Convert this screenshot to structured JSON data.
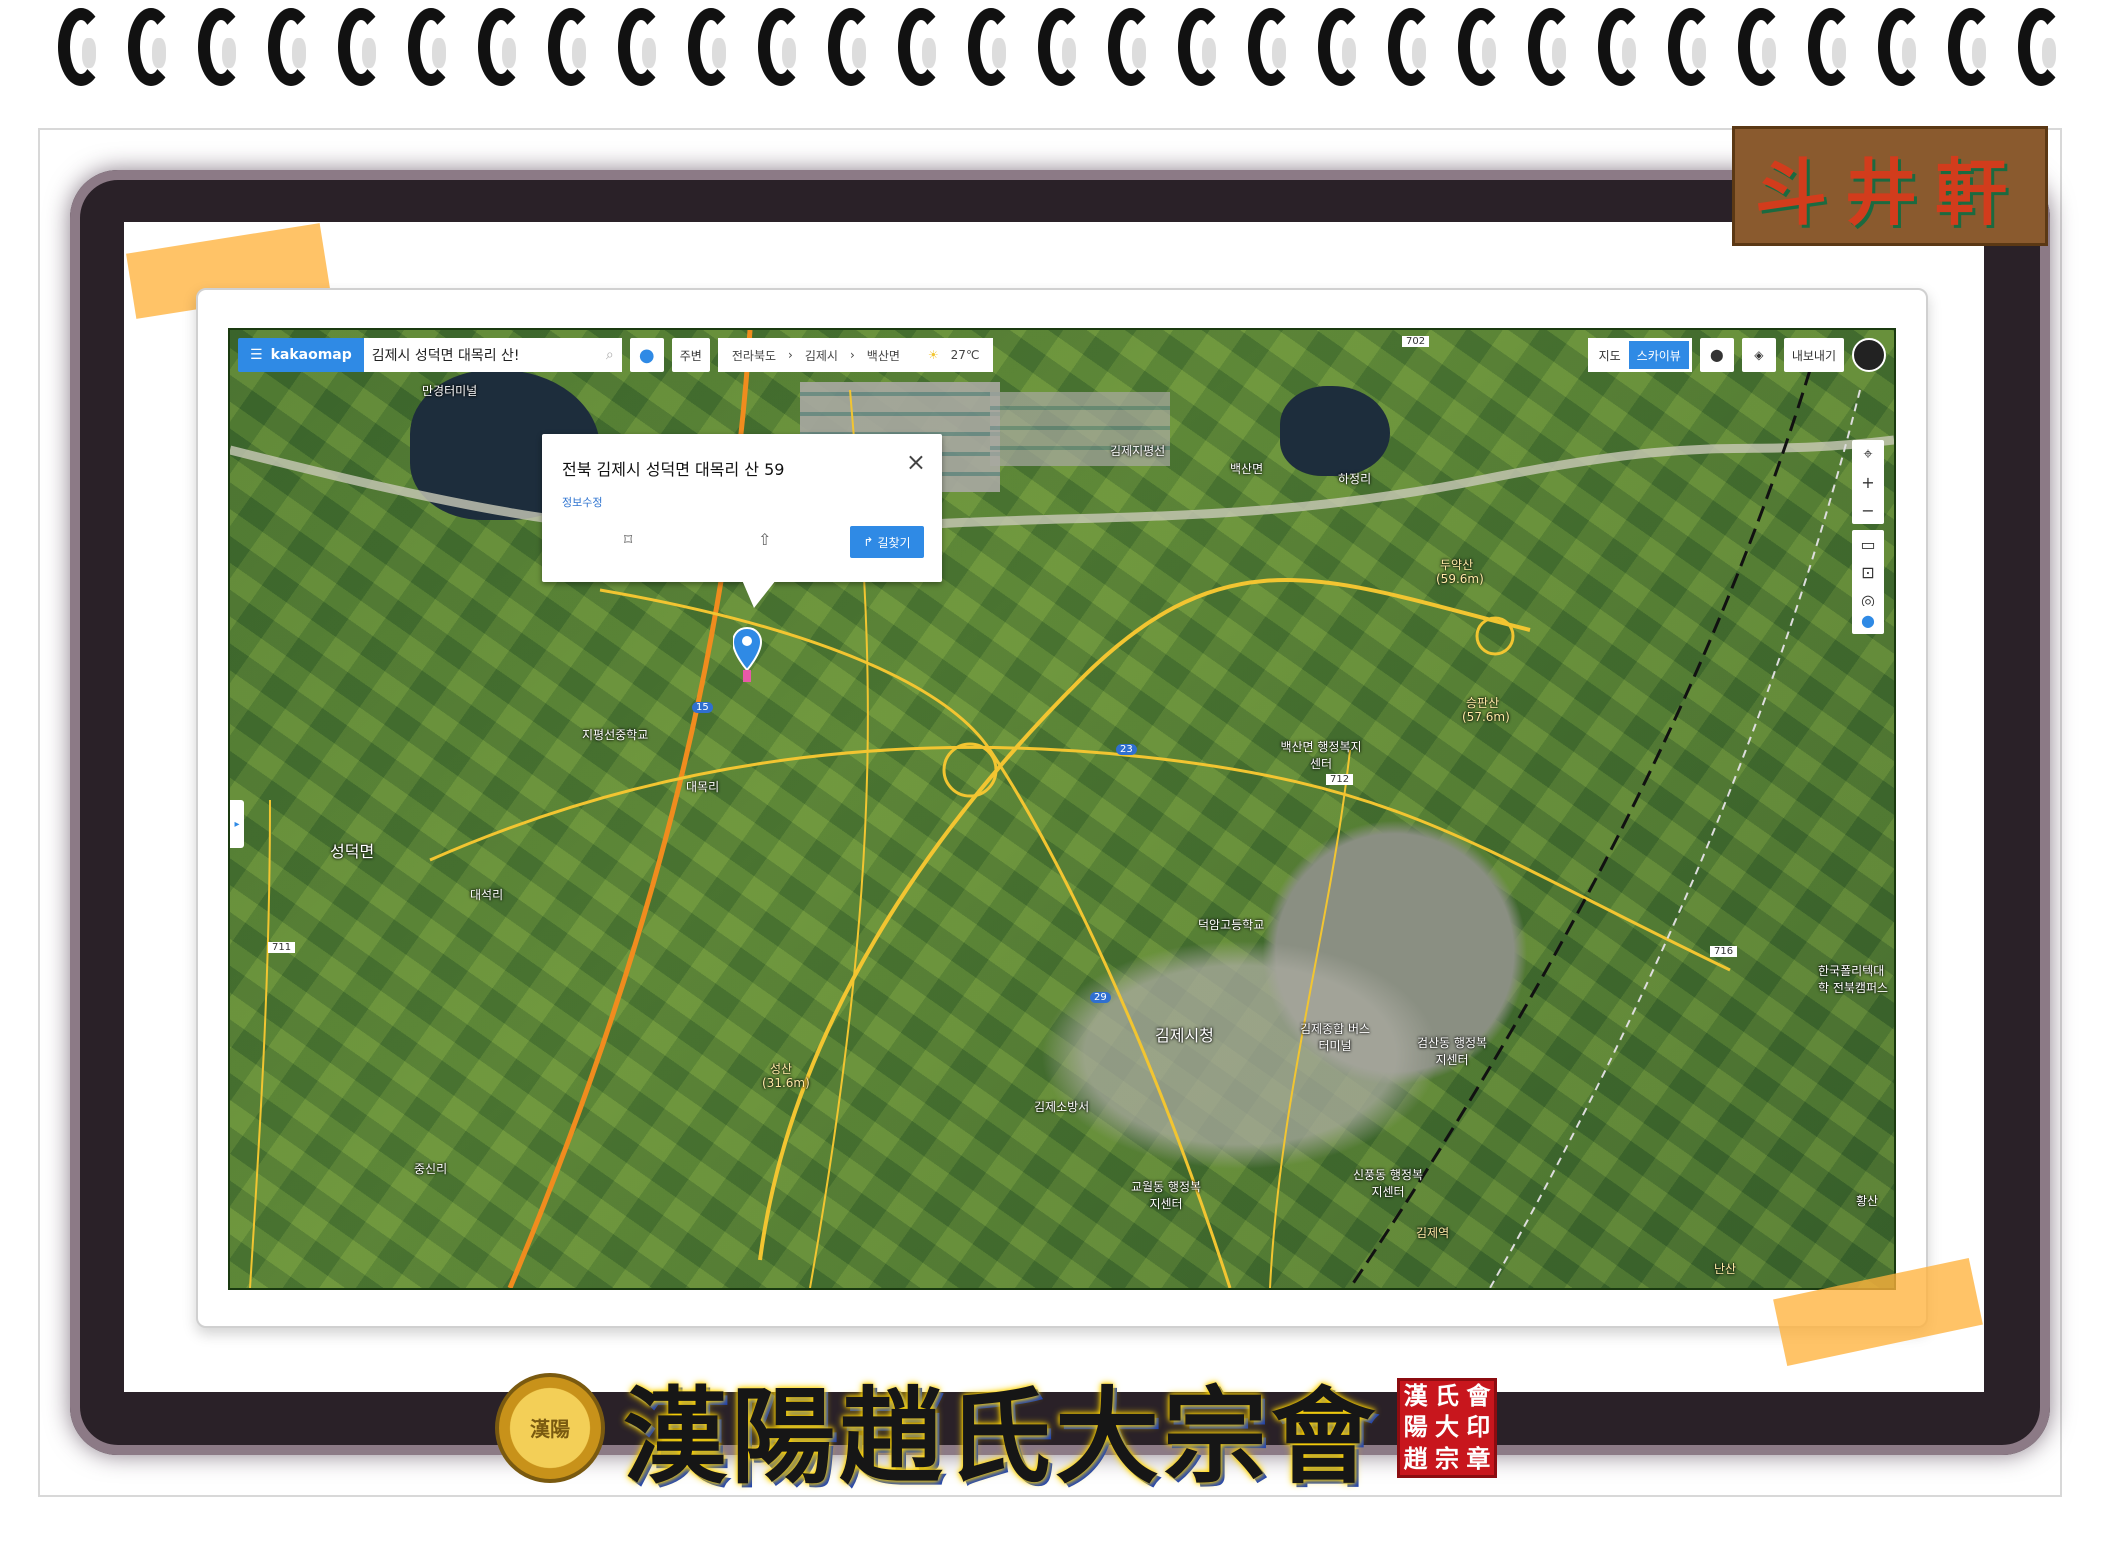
{
  "map_app": {
    "brand": "kakaomap",
    "search_value": "김제시 성덕면 대목리 산!",
    "nearby_label": "주변",
    "breadcrumb": [
      "전라북도",
      "김제시",
      "백산면"
    ],
    "weather_temp": "27℃",
    "view_toggle": [
      {
        "label": "지도",
        "selected": false
      },
      {
        "label": "스카이뷰",
        "selected": true
      }
    ],
    "export_label": "내보내기",
    "accent_color": "#2f8ae5"
  },
  "popup": {
    "address": "전북 김제시 성덕면 대목리 산 59",
    "edit_label": "정보수정",
    "route_label": "길찾기"
  },
  "map_labels": {
    "kimje_city_hall": "김제시청",
    "baeksan": "백산면",
    "seongdeok": "성덕면",
    "jipyeong_school": "지평선중학교",
    "deogam_school": "덕암고등학교",
    "industrial": "김제지평선",
    "duyaksan": "두약산",
    "duyaksan_elev": "(59.6m)",
    "seungwangsan": "승판산",
    "seungwangsan_elev": "(57.6m)",
    "seongsan": "성산",
    "seongsan_elev": "(31.6m)",
    "daemok_ri": "대목리",
    "daeseok_ri": "대석리",
    "jungsin_ri": "중신리",
    "haseong_ri": "하정리",
    "manggyeong": "만경터미널",
    "kimje_station": "김제역",
    "hwangsan": "황산",
    "nansan": "난산",
    "baeksan_office": "백산면 행정복지센터",
    "geomsan_office": "검산동 행정복지센터",
    "sinpung_office": "신풍동 행정복지센터",
    "gyowol_office": "교월동 행정복지센터",
    "hanuk_univ": "한국폴리텍대학 전북캠퍼스",
    "kimje_fire": "김제소방서",
    "kimje_terminal": "김제종합 버스터미널",
    "road_702": "702",
    "road_712": "712",
    "road_711": "711",
    "road_716": "716",
    "road_29": "29",
    "road_23": "23",
    "road_15": "15"
  },
  "decor": {
    "logo_text": "斗井軒",
    "banner_title": "漢陽趙氏大宗會",
    "emblem_text": "漢陽",
    "seal_chars": [
      "漢",
      "氏",
      "會",
      "陽",
      "大",
      "印",
      "趙",
      "宗",
      "章"
    ]
  }
}
